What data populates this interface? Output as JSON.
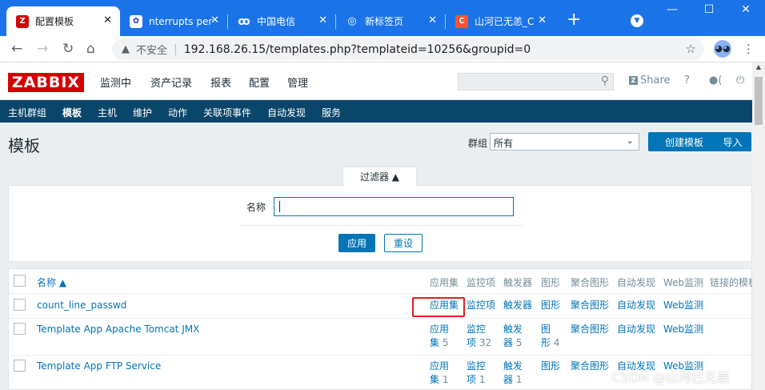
{
  "browser": {
    "tabs": [
      {
        "title": "配置模板",
        "favicon": "Z",
        "color": "#d40000",
        "active": true
      },
      {
        "title": "nterrupts per",
        "favicon": "baidu-icon",
        "color": "#2932e1",
        "active": false
      },
      {
        "title": "中国电信",
        "favicon": "telecom-icon",
        "color": "#0a65c8",
        "active": false
      },
      {
        "title": "新标签页",
        "favicon": "chrome-icon",
        "color": "#5f6368",
        "active": false
      },
      {
        "title": "山河已无恙_C",
        "favicon": "C",
        "color": "#fc5531",
        "active": false
      }
    ],
    "new_tab": "+",
    "insecure_label": "不安全",
    "url": "192.168.26.15/templates.php?templateid=10256&groupid=0"
  },
  "zabbix": {
    "logo": "ZABBIX",
    "main_menu": [
      "监测中",
      "资产记录",
      "报表",
      "配置",
      "管理"
    ],
    "share_label": "Share",
    "help_label": "?",
    "sub_menu": [
      "主机群组",
      "模板",
      "主机",
      "维护",
      "动作",
      "关联项事件",
      "自动发现",
      "服务"
    ],
    "page_title": "模板",
    "group_label": "群组",
    "group_value": "所有",
    "create_button": "创建模板",
    "import_button": "导入",
    "filter_tab": "过滤器 ▲",
    "filter_name_label": "名称",
    "apply_button": "应用",
    "reset_button": "重设",
    "columns": [
      "名称 ▲",
      "应用集",
      "监控项",
      "触发器",
      "图形",
      "聚合图形",
      "自动发现",
      "Web监测",
      "链接的模板"
    ],
    "rows": [
      {
        "name": "count_line_passwd",
        "app1": "应用集",
        "app2": "",
        "app_cnt": "",
        "item1": "监控项",
        "item2": "",
        "item_cnt": "",
        "trig1": "触发器",
        "trig2": "",
        "trig_cnt": "",
        "graph1": "图形",
        "graph2": "",
        "graph_cnt": "",
        "screens": "聚合图形",
        "discovery": "自动发现",
        "web": "Web监测"
      },
      {
        "name": "Template App Apache Tomcat JMX",
        "app1": "应用",
        "app2": "集",
        "app_cnt": "5",
        "item1": "监控",
        "item2": "项",
        "item_cnt": "32",
        "trig1": "触发",
        "trig2": "器",
        "trig_cnt": "5",
        "graph1": "图",
        "graph2": "形",
        "graph_cnt": "4",
        "screens": "聚合图形",
        "discovery": "自动发现",
        "web": "Web监测"
      },
      {
        "name": "Template App FTP Service",
        "app1": "应用",
        "app2": "集",
        "app_cnt": "1",
        "item1": "监控",
        "item2": "项",
        "item_cnt": "1",
        "trig1": "触发",
        "trig2": "器",
        "trig_cnt": "1",
        "graph1": "图形",
        "graph2": "",
        "graph_cnt": "",
        "screens": "聚合图形",
        "discovery": "自动发现",
        "web": "Web监测"
      }
    ]
  },
  "watermark": "CSDN @山河已无恙",
  "colors": {
    "brand": "#d40000",
    "link": "#0275b8",
    "nav": "#0a466a",
    "chrome": "#1b73e8",
    "highlight": "#e0201f"
  }
}
